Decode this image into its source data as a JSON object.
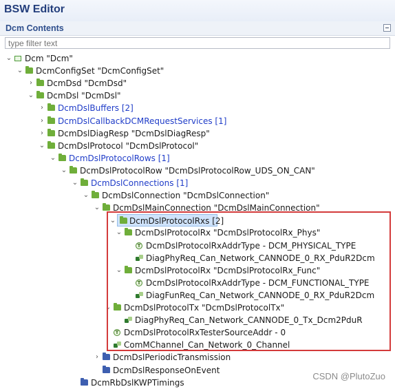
{
  "header": {
    "title": "BSW Editor"
  },
  "section": {
    "title": "Dcm Contents"
  },
  "filter": {
    "placeholder": "type filter text"
  },
  "tree": [
    {
      "label": "Dcm \"Dcm\"",
      "toggle": "⌄",
      "icon": "module-icon",
      "link": false
    },
    {
      "label": "DcmConfigSet \"DcmConfigSet\"",
      "toggle": "⌄",
      "icon": "folder-icon",
      "link": false
    },
    {
      "label": "DcmDsd \"DcmDsd\"",
      "toggle": "›",
      "icon": "folder-icon",
      "link": false
    },
    {
      "label": "DcmDsl \"DcmDsl\"",
      "toggle": "⌄",
      "icon": "folder-icon",
      "link": false
    },
    {
      "label": "DcmDslBuffers [2]",
      "toggle": "›",
      "icon": "folder-icon",
      "link": true
    },
    {
      "label": "DcmDslCallbackDCMRequestServices [1]",
      "toggle": "›",
      "icon": "folder-icon",
      "link": true
    },
    {
      "label": "DcmDslDiagResp \"DcmDslDiagResp\"",
      "toggle": "›",
      "icon": "folder-icon",
      "link": false
    },
    {
      "label": "DcmDslProtocol \"DcmDslProtocol\"",
      "toggle": "⌄",
      "icon": "folder-icon",
      "link": false
    },
    {
      "label": "DcmDslProtocolRows [1]",
      "toggle": "⌄",
      "icon": "folder-icon",
      "link": true
    },
    {
      "label": "DcmDslProtocolRow \"DcmDslProtocolRow_UDS_ON_CAN\"",
      "toggle": "⌄",
      "icon": "folder-icon",
      "link": false
    },
    {
      "label": "DcmDslConnections [1]",
      "toggle": "⌄",
      "icon": "folder-icon",
      "link": true
    },
    {
      "label": "DcmDslConnection \"DcmDslConnection\"",
      "toggle": "⌄",
      "icon": "folder-icon",
      "link": false
    },
    {
      "label": "DcmDslMainConnection \"DcmDslMainConnection\"",
      "toggle": "⌄",
      "icon": "folder-icon",
      "link": false
    },
    {
      "label": "DcmDslProtocolRxs [2]",
      "toggle": "⌄",
      "icon": "folder-icon",
      "link": false
    },
    {
      "label": "DcmDslProtocolRx \"DcmDslProtocolRx_Phys\"",
      "toggle": "⌄",
      "icon": "folder-icon",
      "link": false
    },
    {
      "label": "DcmDslProtocolRxAddrType - DCM_PHYSICAL_TYPE",
      "toggle": "",
      "icon": "parameter-icon",
      "link": false
    },
    {
      "label": "DiagPhyReq_Can_Network_CANNODE_0_RX_PduR2Dcm",
      "toggle": "",
      "icon": "reference-icon",
      "link": false
    },
    {
      "label": "DcmDslProtocolRx \"DcmDslProtocolRx_Func\"",
      "toggle": "⌄",
      "icon": "folder-icon",
      "link": false
    },
    {
      "label": "DcmDslProtocolRxAddrType - DCM_FUNCTIONAL_TYPE",
      "toggle": "",
      "icon": "parameter-icon",
      "link": false
    },
    {
      "label": "DiagFunReq_Can_Network_CANNODE_0_RX_PduR2Dcm",
      "toggle": "",
      "icon": "reference-icon",
      "link": false
    },
    {
      "label": "DcmDslProtocolTx \"DcmDslProtocolTx\"",
      "toggle": "⌄",
      "icon": "folder-icon",
      "link": false
    },
    {
      "label": "DiagPhyReq_Can_Network_CANNODE_0_Tx_Dcm2PduR",
      "toggle": "",
      "icon": "reference-icon",
      "link": false
    },
    {
      "label": "DcmDslProtocolRxTesterSourceAddr - 0",
      "toggle": "",
      "icon": "parameter-icon",
      "link": false
    },
    {
      "label": "ComMChannel_Can_Network_0_Channel",
      "toggle": "",
      "icon": "reference-icon",
      "link": false
    },
    {
      "label": "DcmDslPeriodicTransmission",
      "toggle": "›",
      "icon": "folder-blue-icon",
      "link": false
    },
    {
      "label": "DcmDslResponseOnEvent",
      "toggle": "",
      "icon": "folder-blue-icon",
      "link": false
    },
    {
      "label": "DcmRbDslKWPTimings",
      "toggle": "",
      "icon": "folder-blue-icon",
      "link": false
    }
  ],
  "watermark": "CSDN @PlutoZuo"
}
